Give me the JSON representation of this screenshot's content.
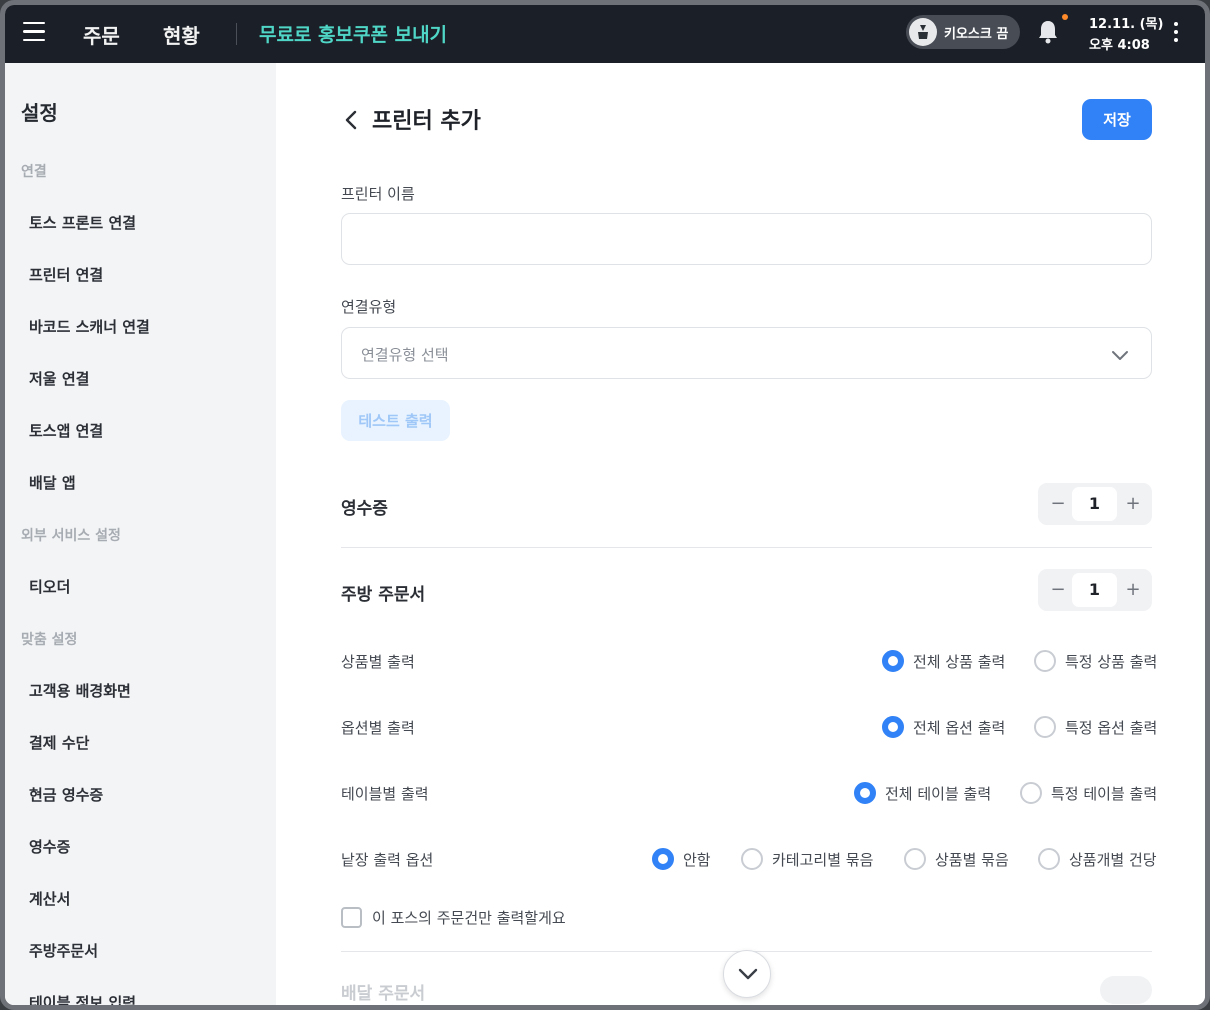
{
  "topbar": {
    "tabs": [
      "주문",
      "현황"
    ],
    "promo_link": "무료로 홍보쿠폰 보내기",
    "kiosk_toggle": "키오스크 끔",
    "date": "12.11. (목)",
    "time": "오후 4:08"
  },
  "sidebar": {
    "title": "설정",
    "sections": [
      "연결",
      "외부 서비스 설정",
      "맞춤 설정"
    ],
    "connect_items": [
      "토스 프론트 연결",
      "프린터 연결",
      "바코드 스캐너 연결",
      "저울 연결",
      "토스앱 연결",
      "배달 앱"
    ],
    "external_items": [
      "티오더"
    ],
    "custom_items": [
      "고객용 배경화면",
      "결제 수단",
      "현금 영수증",
      "영수증",
      "계산서",
      "주방주문서",
      "테이블 정보 입력"
    ]
  },
  "main": {
    "title": "프린터 추가",
    "save_label": "저장",
    "printer_name_label": "프린터 이름",
    "printer_name_value": "",
    "connection_type_label": "연결유형",
    "connection_type_placeholder": "연결유형 선택",
    "test_print_label": "테스트 출력",
    "receipt": {
      "label": "영수증",
      "count": "1"
    },
    "kitchen": {
      "label": "주방 주문서",
      "count": "1"
    },
    "options": {
      "by_product": {
        "label": "상품별 출력",
        "choices": [
          "전체 상품 출력",
          "특정 상품 출력"
        ],
        "selected": 0
      },
      "by_option": {
        "label": "옵션별 출력",
        "choices": [
          "전체 옵션 출력",
          "특정 옵션 출력"
        ],
        "selected": 0
      },
      "by_table": {
        "label": "테이블별 출력",
        "choices": [
          "전체 테이블 출력",
          "특정 테이블 출력"
        ],
        "selected": 0
      },
      "per_sheet": {
        "label": "낱장 출력 옵션",
        "choices": [
          "안함",
          "카테고리별 묶음",
          "상품별 묶음",
          "상품개별 건당"
        ],
        "selected": 0
      }
    },
    "only_this_pos_label": "이 포스의 주문건만 출력할게요",
    "only_this_pos_checked": false,
    "delivery_label": "배달 주문서"
  },
  "colors": {
    "accent": "#3182f6",
    "topbar_bg": "#1b1f27",
    "promo": "#4fd6c6"
  },
  "icons": [
    "menu-icon",
    "robot-icon",
    "bell-icon",
    "more-vertical-icon",
    "chevron-left-icon",
    "chevron-down-icon"
  ]
}
